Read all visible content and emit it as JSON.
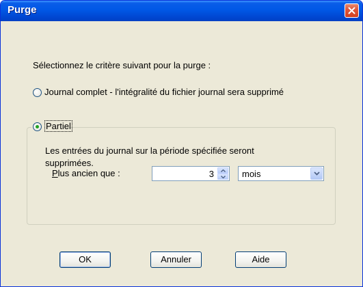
{
  "window": {
    "title": "Purge",
    "close_icon": "close-icon"
  },
  "prompt": "Sélectionnez le critère suivant pour la purge :",
  "options": {
    "full": {
      "label": "Journal complet - l'intégralité du fichier journal sera supprimé",
      "selected": false
    },
    "partial": {
      "label": "Partiel",
      "selected": true
    }
  },
  "partial_group": {
    "description_line1": "Les entrées du journal sur la période spécifiée seront",
    "description_line2": "supprimées.",
    "older_than_label": "Plus ancien que :",
    "older_than_value": "3",
    "unit_value": "mois"
  },
  "buttons": {
    "ok": "OK",
    "cancel": "Annuler",
    "help": "Aide"
  },
  "colors": {
    "title_bar": "#0058e6",
    "close_button": "#e0573b",
    "radio_dot": "#21a121"
  }
}
